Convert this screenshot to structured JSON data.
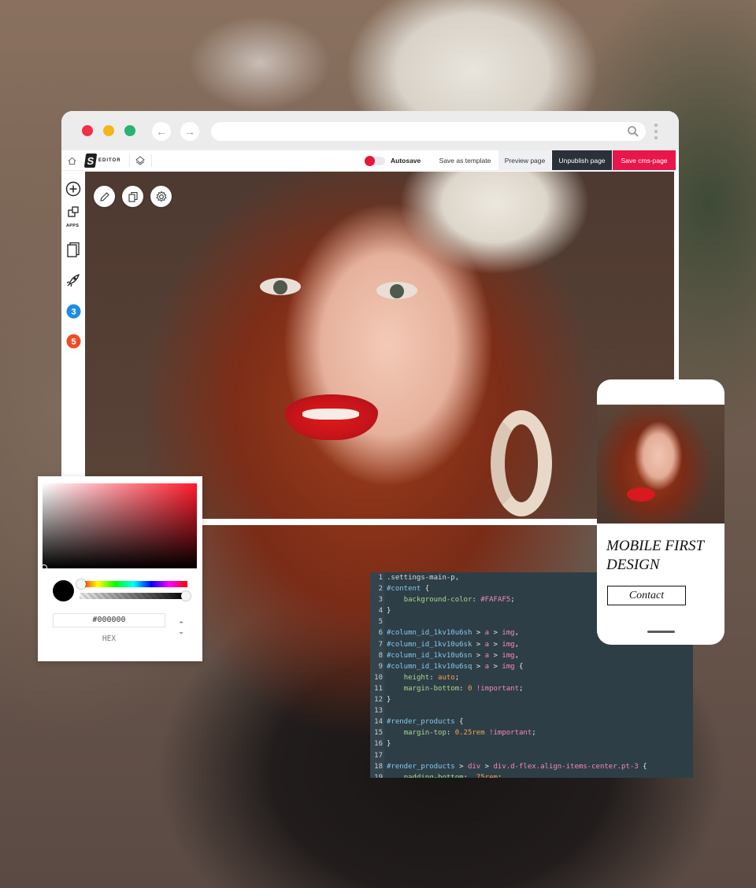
{
  "browser": {
    "url": "",
    "editor_bar": {
      "logo_text": "EDITOR",
      "autosave_label": "Autosave",
      "save_template_label": "Save as template",
      "preview_label": "Preview page",
      "unpublish_label": "Unpublish page",
      "save_cms_label": "Save cms-page"
    },
    "sidebar": {
      "apps_label": "APPS",
      "icons": [
        "add-circle-icon",
        "apps-icon",
        "pages-icon",
        "rocket-icon",
        "css3-icon",
        "html5-icon"
      ]
    },
    "canvas_tools": [
      "pencil-icon",
      "copy-icon",
      "settings-icon"
    ]
  },
  "color_picker": {
    "hex_value": "#000000",
    "mode_label": "HEX",
    "hue_color": "#ff1a2b"
  },
  "code_editor": {
    "lines": [
      {
        "n": "1",
        "parts": [
          [
            "c-sel",
            ".settings-main-p,"
          ]
        ]
      },
      {
        "n": "2",
        "parts": [
          [
            "c-id",
            "#content"
          ],
          [
            "c-punct",
            " {"
          ]
        ]
      },
      {
        "n": "3",
        "parts": [
          [
            "c-punct",
            "    "
          ],
          [
            "c-prop",
            "background-color"
          ],
          [
            "c-punct",
            ": "
          ],
          [
            "c-imp",
            "#FAFAF5"
          ],
          [
            "c-punct",
            ";"
          ]
        ]
      },
      {
        "n": "4",
        "parts": [
          [
            "c-punct",
            "}"
          ]
        ]
      },
      {
        "n": "5",
        "parts": []
      },
      {
        "n": "6",
        "parts": [
          [
            "c-id",
            "#column_id_1kv10u6sh"
          ],
          [
            "c-punct",
            " > "
          ],
          [
            "c-imp",
            "a"
          ],
          [
            "c-punct",
            " > "
          ],
          [
            "c-imp",
            "img"
          ],
          [
            "c-punct",
            ","
          ]
        ]
      },
      {
        "n": "7",
        "parts": [
          [
            "c-id",
            "#column_id_1kv10u6sk"
          ],
          [
            "c-punct",
            " > "
          ],
          [
            "c-imp",
            "a"
          ],
          [
            "c-punct",
            " > "
          ],
          [
            "c-imp",
            "img"
          ],
          [
            "c-punct",
            ","
          ]
        ]
      },
      {
        "n": "8",
        "parts": [
          [
            "c-id",
            "#column_id_1kv10u6sn"
          ],
          [
            "c-punct",
            " > "
          ],
          [
            "c-imp",
            "a"
          ],
          [
            "c-punct",
            " > "
          ],
          [
            "c-imp",
            "img"
          ],
          [
            "c-punct",
            ","
          ]
        ]
      },
      {
        "n": "9",
        "parts": [
          [
            "c-id",
            "#column_id_1kv10u6sq"
          ],
          [
            "c-punct",
            " > "
          ],
          [
            "c-imp",
            "a"
          ],
          [
            "c-punct",
            " > "
          ],
          [
            "c-imp",
            "img"
          ],
          [
            "c-punct",
            " {"
          ]
        ]
      },
      {
        "n": "10",
        "parts": [
          [
            "c-punct",
            "    "
          ],
          [
            "c-prop",
            "height"
          ],
          [
            "c-punct",
            ": "
          ],
          [
            "c-val",
            "auto"
          ],
          [
            "c-punct",
            ";"
          ]
        ]
      },
      {
        "n": "11",
        "parts": [
          [
            "c-punct",
            "    "
          ],
          [
            "c-prop",
            "margin-bottom"
          ],
          [
            "c-punct",
            ": "
          ],
          [
            "c-val",
            "0"
          ],
          [
            "c-punct",
            " "
          ],
          [
            "c-imp",
            "!important"
          ],
          [
            "c-punct",
            ";"
          ]
        ]
      },
      {
        "n": "12",
        "parts": [
          [
            "c-punct",
            "}"
          ]
        ]
      },
      {
        "n": "13",
        "parts": []
      },
      {
        "n": "14",
        "parts": [
          [
            "c-id",
            "#render_products"
          ],
          [
            "c-punct",
            " {"
          ]
        ]
      },
      {
        "n": "15",
        "parts": [
          [
            "c-punct",
            "    "
          ],
          [
            "c-prop",
            "margin-top"
          ],
          [
            "c-punct",
            ": "
          ],
          [
            "c-val",
            "0.25rem"
          ],
          [
            "c-punct",
            " "
          ],
          [
            "c-imp",
            "!important"
          ],
          [
            "c-punct",
            ";"
          ]
        ]
      },
      {
        "n": "16",
        "parts": [
          [
            "c-punct",
            "}"
          ]
        ]
      },
      {
        "n": "17",
        "parts": []
      },
      {
        "n": "18",
        "parts": [
          [
            "c-id",
            "#render_products"
          ],
          [
            "c-punct",
            " > "
          ],
          [
            "c-imp",
            "div"
          ],
          [
            "c-punct",
            " > "
          ],
          [
            "c-imp",
            "div.d-flex.align-items-center.pt-3"
          ],
          [
            "c-punct",
            " {"
          ]
        ]
      },
      {
        "n": "19",
        "parts": [
          [
            "c-punct",
            "    "
          ],
          [
            "c-prop",
            "padding-bottom"
          ],
          [
            "c-punct",
            ": "
          ],
          [
            "c-val",
            ".75rem"
          ],
          [
            "c-punct",
            ";"
          ]
        ]
      }
    ]
  },
  "mobile_preview": {
    "title": "MOBILE FIRST DESIGN",
    "contact_label": "Contact"
  }
}
